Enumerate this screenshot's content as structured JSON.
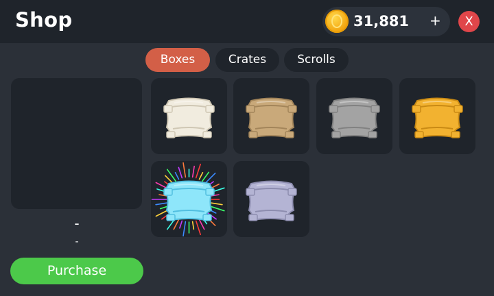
{
  "header": {
    "title": "Shop",
    "coins": "31,881",
    "add_label": "+",
    "close_label": "X"
  },
  "tabs": [
    {
      "label": "Boxes",
      "active": true
    },
    {
      "label": "Crates",
      "active": false
    },
    {
      "label": "Scrolls",
      "active": false
    }
  ],
  "preview": {
    "name": "-",
    "price": "-"
  },
  "purchase_label": "Purchase",
  "items": [
    {
      "name": "white-box",
      "color": "#f1ecdf",
      "shade": "#cfc7b4"
    },
    {
      "name": "brown-box",
      "color": "#c9a97a",
      "shade": "#a3855a"
    },
    {
      "name": "gray-box",
      "color": "#a3a3a3",
      "shade": "#818181"
    },
    {
      "name": "gold-box",
      "color": "#f2b230",
      "shade": "#c98a14"
    },
    {
      "name": "diamond-box",
      "color": "#8ee6fa",
      "shade": "#52bfe0"
    },
    {
      "name": "silver-box",
      "color": "#b4b4d4",
      "shade": "#8d8daf"
    }
  ],
  "colors": {
    "background": "#2b3038",
    "panel": "#1f242b",
    "tab_active": "#d35f47",
    "purchase": "#4cc94a",
    "close": "#e0464a"
  }
}
